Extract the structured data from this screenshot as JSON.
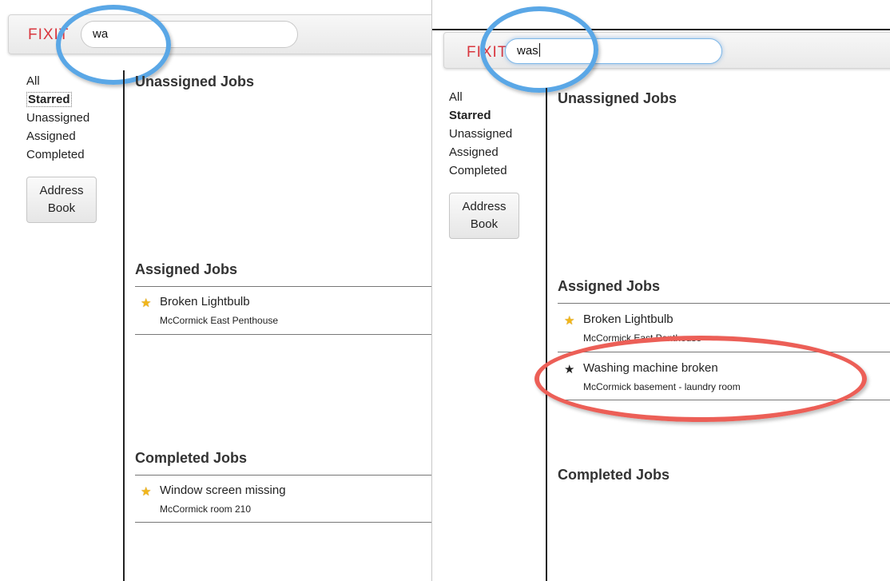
{
  "left": {
    "logo": "FIXIT",
    "search_value": "wa",
    "nav": [
      "All",
      "Starred",
      "Unassigned",
      "Assigned",
      "Completed"
    ],
    "active_nav": "Starred",
    "address_book": "Address Book",
    "sections": {
      "unassigned": "Unassigned Jobs",
      "assigned": "Assigned Jobs",
      "completed": "Completed Jobs"
    },
    "assigned_jobs": [
      {
        "title": "Broken Lightbulb",
        "location": "McCormick East Penthouse",
        "starred": true
      }
    ],
    "completed_jobs": [
      {
        "title": "Window screen missing",
        "location": "McCormick room 210",
        "starred": true
      }
    ]
  },
  "right": {
    "logo": "FIXIT",
    "search_value": "was",
    "nav": [
      "All",
      "Starred",
      "Unassigned",
      "Assigned",
      "Completed"
    ],
    "active_nav": "Starred",
    "address_book": "Address Book",
    "sections": {
      "unassigned": "Unassigned Jobs",
      "assigned": "Assigned Jobs",
      "completed": "Completed Jobs"
    },
    "assigned_jobs": [
      {
        "title": "Broken Lightbulb",
        "location": "McCormick East Penthouse",
        "starred": true
      },
      {
        "title": "Washing machine broken",
        "location": "McCormick basement - laundry room",
        "starred": false
      }
    ]
  },
  "colors": {
    "logo": "#d9363e",
    "highlight_blue": "#5aa7e6",
    "highlight_red": "#ec5f57",
    "star_gold": "#f2b619"
  },
  "icons": {
    "starred": "star-filled-gold-icon",
    "unstarred": "star-filled-black-icon"
  }
}
